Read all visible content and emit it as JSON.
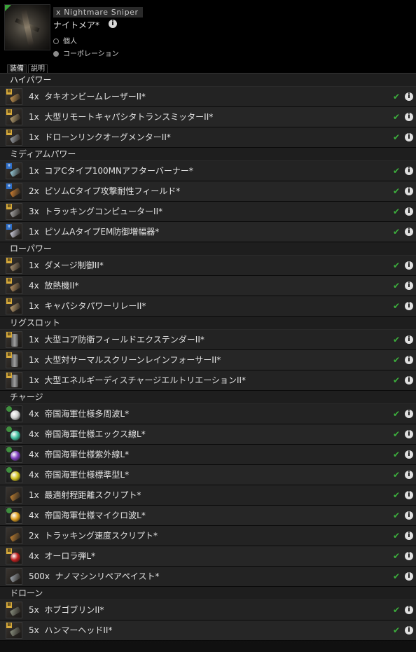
{
  "ship": {
    "name": "x Nightmare Sniper",
    "type": "ナイトメア*",
    "info_icon": "i"
  },
  "radio": {
    "personal": "個人",
    "corporation": "コーポレーション"
  },
  "tabs": [
    "装備",
    "説明"
  ],
  "sections": [
    {
      "title": "ハイパワー",
      "items": [
        {
          "qty": "4x",
          "name": "タキオンビームレーザーII*",
          "icon": "laser-turret-icon",
          "badge": "t2",
          "color": "#c89650"
        },
        {
          "qty": "1x",
          "name": "大型リモートキャパシタトランスミッターII*",
          "icon": "cap-transmitter-icon",
          "badge": "t2",
          "color": "#b8a070"
        },
        {
          "qty": "1x",
          "name": "ドローンリンクオーグメンターII*",
          "icon": "drone-link-icon",
          "badge": "t2",
          "color": "#9aa0a8"
        }
      ]
    },
    {
      "title": "ミディアムパワー",
      "items": [
        {
          "qty": "1x",
          "name": "コアCタイプ100MNアフターバーナー*",
          "icon": "afterburner-icon",
          "badge": "faction",
          "color": "#9ad0e0"
        },
        {
          "qty": "2x",
          "name": "ピソムCタイプ攻撃耐性フィールド*",
          "icon": "shield-hardener-icon",
          "badge": "faction",
          "color": "#d08030"
        },
        {
          "qty": "3x",
          "name": "トラッキングコンピューターII*",
          "icon": "tracking-computer-icon",
          "badge": "t2",
          "color": "#a8a8a8"
        },
        {
          "qty": "1x",
          "name": "ピソムAタイプEM防御増幅器*",
          "icon": "em-amplifier-icon",
          "badge": "faction",
          "color": "#d0d0e0"
        }
      ]
    },
    {
      "title": "ローパワー",
      "items": [
        {
          "qty": "1x",
          "name": "ダメージ制御II*",
          "icon": "damage-control-icon",
          "badge": "t2",
          "color": "#a89070"
        },
        {
          "qty": "4x",
          "name": "放熱機II*",
          "icon": "heat-sink-icon",
          "badge": "t2",
          "color": "#b89060"
        },
        {
          "qty": "1x",
          "name": "キャパシタパワーリレーII*",
          "icon": "power-relay-icon",
          "badge": "t2",
          "color": "#c0a070"
        }
      ]
    },
    {
      "title": "リグスロット",
      "items": [
        {
          "qty": "1x",
          "name": "大型コア防衛フィールドエクステンダーII*",
          "icon": "rig-icon",
          "badge": "t2",
          "color": "#a0a0a0"
        },
        {
          "qty": "1x",
          "name": "大型対サーマルスクリーンレインフォーサーII*",
          "icon": "rig-icon",
          "badge": "t2",
          "color": "#a0a0a0"
        },
        {
          "qty": "1x",
          "name": "大型エネルギーディスチャージエルトリエーションII*",
          "icon": "rig-icon",
          "badge": "t2",
          "color": "#a0a0a0"
        }
      ]
    },
    {
      "title": "チャージ",
      "items": [
        {
          "qty": "4x",
          "name": "帝国海軍仕様多周波L*",
          "icon": "crystal-multifrequency-icon",
          "badge": "ammo",
          "color": "#d0d0d0"
        },
        {
          "qty": "4x",
          "name": "帝国海軍仕様エックス線L*",
          "icon": "crystal-xray-icon",
          "badge": "ammo",
          "color": "#40c0a0"
        },
        {
          "qty": "4x",
          "name": "帝国海軍仕様紫外線L*",
          "icon": "crystal-ultraviolet-icon",
          "badge": "ammo",
          "color": "#8040c0"
        },
        {
          "qty": "4x",
          "name": "帝国海軍仕様標準型L*",
          "icon": "crystal-standard-icon",
          "badge": "ammo",
          "color": "#d0c020"
        },
        {
          "qty": "1x",
          "name": "最適射程距離スクリプト*",
          "icon": "script-icon",
          "badge": "none",
          "color": "#c08030"
        },
        {
          "qty": "4x",
          "name": "帝国海軍仕様マイクロ波L*",
          "icon": "crystal-microwave-icon",
          "badge": "ammo",
          "color": "#e0a020"
        },
        {
          "qty": "2x",
          "name": "トラッキング速度スクリプト*",
          "icon": "script-icon",
          "badge": "none",
          "color": "#c08030"
        },
        {
          "qty": "4x",
          "name": "オーロラ弾L*",
          "icon": "crystal-aurora-icon",
          "badge": "t2",
          "color": "#c02020"
        },
        {
          "qty": "500x",
          "name": "ナノマシンリペアペイスト*",
          "icon": "nanite-paste-icon",
          "badge": "none",
          "color": "#a0a8b0"
        }
      ]
    },
    {
      "title": "ドローン",
      "items": [
        {
          "qty": "5x",
          "name": "ホブゴブリンII*",
          "icon": "drone-icon",
          "badge": "t2",
          "color": "#8a9080"
        },
        {
          "qty": "5x",
          "name": "ハンマーヘッドII*",
          "icon": "drone-icon",
          "badge": "t2",
          "color": "#8a9080"
        }
      ]
    }
  ],
  "status_icon": "✔",
  "info_icon": "i"
}
